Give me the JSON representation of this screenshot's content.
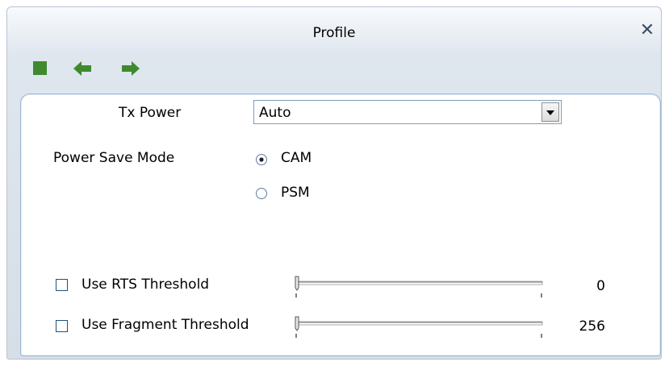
{
  "window": {
    "title": "Profile",
    "close_glyph": "✕"
  },
  "toolbar": {
    "buttons": [
      {
        "icon": "stop-square-icon"
      },
      {
        "icon": "back-arrow-icon"
      },
      {
        "icon": "forward-arrow-icon"
      }
    ]
  },
  "form": {
    "tx_power_label": "Tx Power",
    "tx_power_value": "Auto",
    "power_save_label": "Power Save Mode",
    "power_save_options": [
      {
        "label": "CAM",
        "selected": true
      },
      {
        "label": "PSM",
        "selected": false
      }
    ],
    "rts": {
      "label": "Use RTS Threshold",
      "checked": false,
      "value": "0"
    },
    "fragment": {
      "label": "Use Fragment Threshold",
      "checked": false,
      "value": "256"
    }
  },
  "colors": {
    "accent_green": "#3f8a2e",
    "panel_border": "#9fb6d2"
  }
}
